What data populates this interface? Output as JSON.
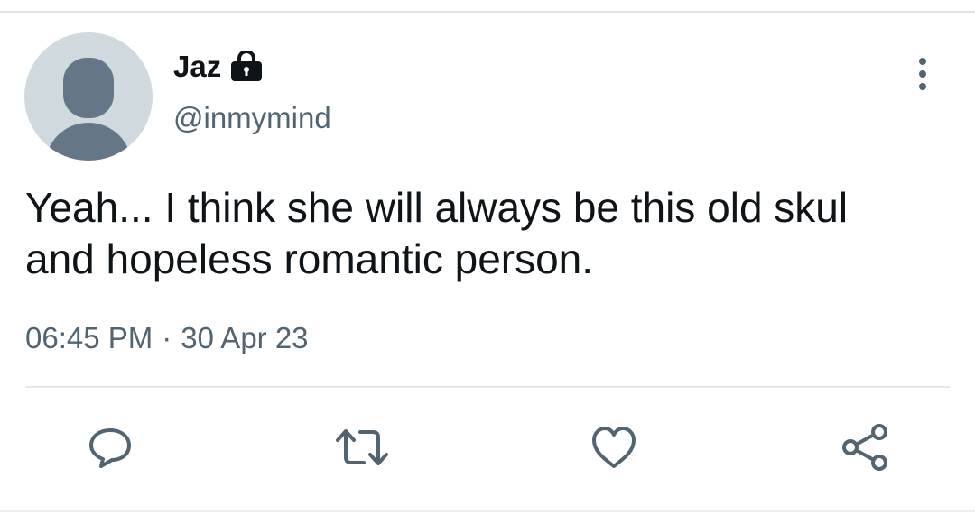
{
  "tweet": {
    "display_name": "Jaz",
    "handle": "@inmymind",
    "text_line1": "Yeah... I think she will always be this old skul",
    "text_line2": "and hopeless romantic person.",
    "time": "06:45 PM",
    "separator": "·",
    "date": "30 Apr 23"
  },
  "icons": {
    "avatar": "default-avatar-icon",
    "protected": "lock-icon",
    "more": "more-vertical-icon",
    "reply": "reply-icon",
    "retweet": "retweet-icon",
    "like": "heart-icon",
    "share": "share-icon"
  },
  "colors": {
    "text_primary": "#0f1419",
    "text_secondary": "#536471",
    "icon_gray": "#536471",
    "avatar_bg": "#cfd9de",
    "avatar_fg": "#657786",
    "divider": "#e6e9eb"
  }
}
